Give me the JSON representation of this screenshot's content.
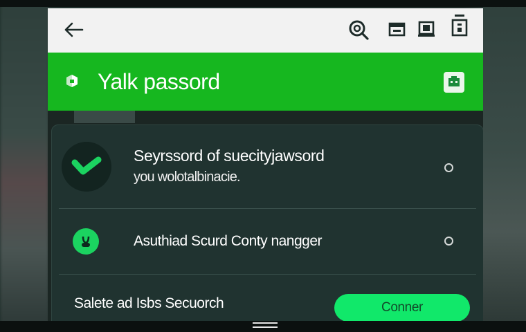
{
  "toolbar": {
    "back_icon": "arrow-left-icon",
    "icons": [
      "search-icon",
      "card-icon",
      "device-icon",
      "document-icon"
    ]
  },
  "header": {
    "title": "Yalk passord",
    "logo_icon": "shield-logo-icon",
    "action_icon": "wallet-icon",
    "color": "#16b71f"
  },
  "card": {
    "items": [
      {
        "icon": "checkmark-icon",
        "primary": "Seyrssord of suecityjawsord",
        "secondary": "you wolotalbinacie.",
        "selected": false
      },
      {
        "icon": "lock-icon",
        "label": "Asuthiad Scurd Conty nangger",
        "selected": false
      }
    ],
    "footer_label": "Salete ad Isbs Secuorch",
    "connect_label": "Conner",
    "accent": "#11e86a"
  }
}
